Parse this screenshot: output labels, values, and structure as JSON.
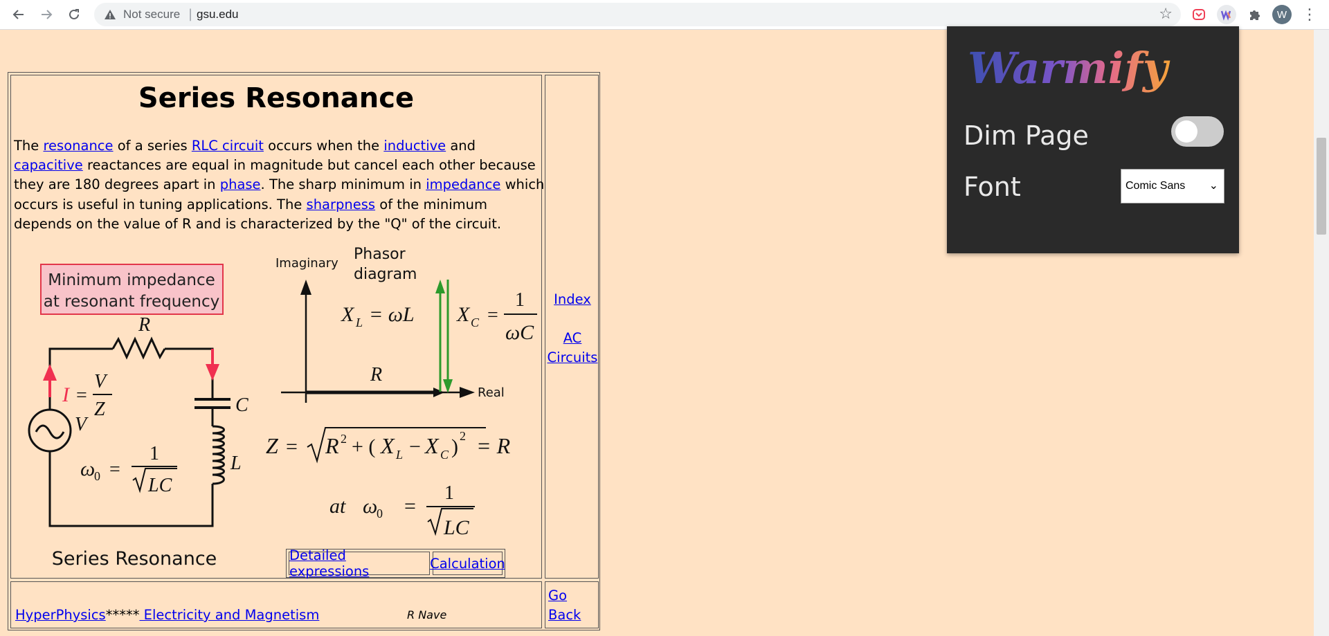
{
  "browser": {
    "back_icon": "arrow-left-icon",
    "forward_icon": "arrow-right-icon",
    "reload_icon": "reload-icon",
    "security_label": "Not secure",
    "separator": "|",
    "url": "gsu.edu",
    "bookmark_icon": "star-icon",
    "profile_initial": "W"
  },
  "page": {
    "title": "Series Resonance",
    "paragraph": {
      "t1": "The ",
      "l_resonance": "resonance",
      "t2": " of a series ",
      "l_rlc": "RLC circuit",
      "t3": " occurs when the ",
      "l_inductive": "inductive",
      "t4": " and ",
      "l_capacitive": "capacitive",
      "t5": " reactances are equal in magnitude but cancel each other because they are 180 degrees apart in ",
      "l_phase": "phase",
      "t6": ". The sharp minimum in ",
      "l_impedance": "impedance",
      "t7": " which occurs is useful in tuning applications. The ",
      "l_sharpness": "sharpness",
      "t8": " of the minimum depends on the value of R and is characterized by the \"Q\" of the circuit."
    },
    "figure": {
      "box_line1": "Minimum impedance",
      "box_line2": "at resonant frequency",
      "resistor": "R",
      "capacitor": "C",
      "inductor": "L",
      "source": "V",
      "current_I": "I",
      "eq": "=",
      "frac_V": "V",
      "frac_Z": "Z",
      "omega0": "ω",
      "sub0": "0",
      "one": "1",
      "sqrtLC": "LC",
      "circuit_caption": "Series Resonance",
      "imaginary": "Imaginary",
      "phasor1": "Phasor",
      "phasor2": "diagram",
      "xl_eq": "= ωL",
      "X": "X",
      "subL": "L",
      "subC": "C",
      "omegaC": "ωC",
      "real": "Real",
      "R_axis": "R",
      "Z": "Z",
      "z_eq_mid": "R",
      "sup2": "2",
      "plus": "+ (",
      "minus": "−",
      "close": ")",
      "eqR": "= R",
      "at": "at",
      "omega": "ω"
    },
    "buttons": {
      "detailed": "Detailed expressions",
      "calculation": "Calculation"
    },
    "side": {
      "index": "Index",
      "ac": "AC",
      "circuits": "Circuits",
      "go": "Go",
      "back": "Back"
    },
    "footer": {
      "hyperphysics": "HyperPhysics",
      "stars": "*****",
      "em": " Electricity and Magnetism",
      "author": "R Nave"
    }
  },
  "popup": {
    "logo": "Warmify",
    "dim_label": "Dim Page",
    "dim_on": false,
    "font_label": "Font",
    "font_selected": "Comic Sans"
  }
}
